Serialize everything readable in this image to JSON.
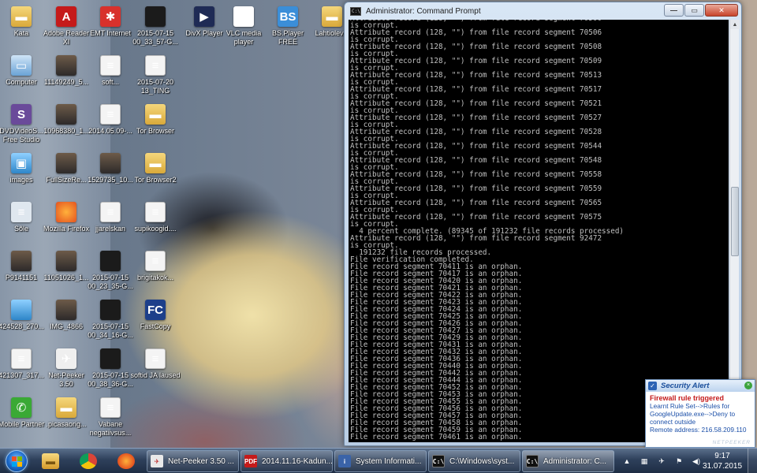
{
  "desktop": {
    "icons": [
      {
        "label": "Kata",
        "icon": "folder-icon",
        "glyph": "▬",
        "style": "g-folder"
      },
      {
        "label": "Adobe Reader XI",
        "icon": "pdf-reader-icon",
        "glyph": "A",
        "style": "g-pdf"
      },
      {
        "label": "EMT Internet",
        "icon": "emt-internet-icon",
        "glyph": "✱",
        "style": "g-red"
      },
      {
        "label": "2015-07-15 00_33_57-G...",
        "icon": "video-thumbnail-icon",
        "glyph": "",
        "style": "g-dark"
      },
      {
        "label": "DivX Player",
        "icon": "divx-player-icon",
        "glyph": "▶",
        "style": "g-divx"
      },
      {
        "label": "VLC media player",
        "icon": "vlc-icon",
        "glyph": "▲",
        "style": "g-vlc"
      },
      {
        "label": "BS.Player FREE",
        "icon": "bsplayer-icon",
        "glyph": "BS",
        "style": "g-bs"
      },
      {
        "label": "Lahtiolev...",
        "icon": "folder-icon",
        "glyph": "▬",
        "style": "g-folder"
      },
      {
        "label": "Computer",
        "icon": "computer-icon",
        "glyph": "▭",
        "style": "g-pc"
      },
      {
        "label": "11149249_5...",
        "icon": "photo-icon",
        "glyph": "",
        "style": "g-photo"
      },
      {
        "label": "soft...",
        "icon": "document-icon",
        "glyph": "≡",
        "style": "g-file"
      },
      {
        "label": "2015-07-20 13_TING",
        "icon": "document-icon",
        "glyph": "≡",
        "style": "g-file"
      },
      {
        "label": "DVDVideoS... Free Studio",
        "icon": "dvd-studio-icon",
        "glyph": "S",
        "style": "g-dvd"
      },
      {
        "label": "10968380_1...",
        "icon": "photo-icon",
        "glyph": "",
        "style": "g-photo"
      },
      {
        "label": "2014.05.09-...",
        "icon": "document-icon",
        "glyph": "≡",
        "style": "g-file"
      },
      {
        "label": "Tor Browser",
        "icon": "folder-icon",
        "glyph": "▬",
        "style": "g-folder"
      },
      {
        "label": "images",
        "icon": "image-folder-icon",
        "glyph": "▣",
        "style": "g-img"
      },
      {
        "label": "FullSizeRe...",
        "icon": "photo-icon",
        "glyph": "",
        "style": "g-photo"
      },
      {
        "label": "1529735_10...",
        "icon": "photo-icon",
        "glyph": "",
        "style": "g-photo"
      },
      {
        "label": "Tor Browser2",
        "icon": "folder-icon",
        "glyph": "▬",
        "style": "g-folder"
      },
      {
        "label": "Sõle",
        "icon": "document-icon",
        "glyph": "≡",
        "style": "g-sole"
      },
      {
        "label": "Mozilla Firefox",
        "icon": "firefox-icon",
        "glyph": "",
        "style": "g-fox"
      },
      {
        "label": "jjarelskan",
        "icon": "document-icon",
        "glyph": "≡",
        "style": "g-file"
      },
      {
        "label": "supikoogid....",
        "icon": "document-icon",
        "glyph": "≡",
        "style": "g-file"
      },
      {
        "label": "P9141151",
        "icon": "photo-icon",
        "glyph": "",
        "style": "g-photo"
      },
      {
        "label": "11051026_1...",
        "icon": "photo-icon",
        "glyph": "",
        "style": "g-photo"
      },
      {
        "label": "2015-07-15 00_23_35-G...",
        "icon": "video-thumbnail-icon",
        "glyph": "",
        "style": "g-dark"
      },
      {
        "label": "brigitakok...",
        "icon": "document-icon",
        "glyph": "≡",
        "style": "g-file"
      },
      {
        "label": "424528_270...",
        "icon": "photo-icon",
        "glyph": "",
        "style": "g-img"
      },
      {
        "label": "IMG_4866",
        "icon": "photo-icon",
        "glyph": "",
        "style": "g-photo"
      },
      {
        "label": "2015-07-15 00_34_16-G...",
        "icon": "video-thumbnail-icon",
        "glyph": "",
        "style": "g-dark"
      },
      {
        "label": "FastCopy",
        "icon": "fastcopy-icon",
        "glyph": "FC",
        "style": "g-fast"
      },
      {
        "label": "421307_317...",
        "icon": "document-icon",
        "glyph": "≡",
        "style": "g-file"
      },
      {
        "label": "Net-Peeker 3.50",
        "icon": "net-peeker-icon",
        "glyph": "✈",
        "style": "g-net"
      },
      {
        "label": "2015-07-15 00_38_36-G...",
        "icon": "video-thumbnail-icon",
        "glyph": "",
        "style": "g-dark"
      },
      {
        "label": "softid JA laused",
        "icon": "document-icon",
        "glyph": "≡",
        "style": "g-file"
      },
      {
        "label": "Mobile Partner",
        "icon": "mobile-partner-icon",
        "glyph": "✆",
        "style": "g-mob"
      },
      {
        "label": ".picasaorig...",
        "icon": "folder-icon",
        "glyph": "▬",
        "style": "g-folder"
      },
      {
        "label": "Vabane negatiivsus...",
        "icon": "document-icon",
        "glyph": "≡",
        "style": "g-file"
      }
    ]
  },
  "console": {
    "title": "Administrator: Command Prompt",
    "icon_text": "C:\\",
    "buttons": {
      "minimize": "—",
      "maximize": "▭",
      "close": "✕"
    },
    "lines": [
      "Attribute record (128, \"\") from file record segment 70500",
      "is corrupt.",
      "Attribute record (128, \"\") from file record segment 70506",
      "is corrupt.",
      "Attribute record (128, \"\") from file record segment 70508",
      "is corrupt.",
      "Attribute record (128, \"\") from file record segment 70509",
      "is corrupt.",
      "Attribute record (128, \"\") from file record segment 70513",
      "is corrupt.",
      "Attribute record (128, \"\") from file record segment 70517",
      "is corrupt.",
      "Attribute record (128, \"\") from file record segment 70521",
      "is corrupt.",
      "Attribute record (128, \"\") from file record segment 70527",
      "is corrupt.",
      "Attribute record (128, \"\") from file record segment 70528",
      "is corrupt.",
      "Attribute record (128, \"\") from file record segment 70544",
      "is corrupt.",
      "Attribute record (128, \"\") from file record segment 70548",
      "is corrupt.",
      "Attribute record (128, \"\") from file record segment 70558",
      "is corrupt.",
      "Attribute record (128, \"\") from file record segment 70559",
      "is corrupt.",
      "Attribute record (128, \"\") from file record segment 70565",
      "is corrupt.",
      "Attribute record (128, \"\") from file record segment 70575",
      "is corrupt.",
      "  4 percent complete. (89345 of 191232 file records processed)",
      "Attribute record (128, \"\") from file record segment 92472",
      "is corrupt.",
      "  191232 file records processed.",
      "File verification completed.",
      "File record segment 70411 is an orphan.",
      "File record segment 70417 is an orphan.",
      "File record segment 70420 is an orphan.",
      "File record segment 70421 is an orphan.",
      "File record segment 70422 is an orphan.",
      "File record segment 70423 is an orphan.",
      "File record segment 70424 is an orphan.",
      "File record segment 70425 is an orphan.",
      "File record segment 70426 is an orphan.",
      "File record segment 70427 is an orphan.",
      "File record segment 70429 is an orphan.",
      "File record segment 70431 is an orphan.",
      "File record segment 70432 is an orphan.",
      "File record segment 70436 is an orphan.",
      "File record segment 70440 is an orphan.",
      "File record segment 70442 is an orphan.",
      "File record segment 70444 is an orphan.",
      "File record segment 70452 is an orphan.",
      "File record segment 70453 is an orphan.",
      "File record segment 70455 is an orphan.",
      "File record segment 70456 is an orphan.",
      "File record segment 70457 is an orphan.",
      "File record segment 70458 is an orphan.",
      "File record segment 70459 is an orphan.",
      "File record segment 70461 is an orphan."
    ]
  },
  "alert": {
    "title": "Security Alert",
    "heading": "Firewall rule triggered",
    "line1": "Learnt Rule Set-->Rules for",
    "line2": "GoogleUpdate.exe-->Deny to",
    "line3": "connect outside",
    "remote": "Remote address: 216.58.209.110",
    "brand": "NETPEEKER",
    "close_glyph": "×"
  },
  "taskbar": {
    "pinned": [
      {
        "name": "explorer-icon",
        "glyph": "▬",
        "style": "p-explorer"
      },
      {
        "name": "chrome-icon",
        "glyph": "",
        "style": "p-chrome"
      },
      {
        "name": "firefox-icon",
        "glyph": "",
        "style": "p-firefox"
      }
    ],
    "tasks": [
      {
        "label": "Net-Peeker 3.50 ...",
        "icon": "net-peeker-icon",
        "glyph": "✈",
        "style": "t-net"
      },
      {
        "label": "2014.11.16-Kadun...",
        "icon": "pdf-icon",
        "glyph": "PDF",
        "style": "t-pdf"
      },
      {
        "label": "System Informati...",
        "icon": "system-info-icon",
        "glyph": "i",
        "style": "t-sys"
      },
      {
        "label": "C:\\Windows\\syst...",
        "icon": "console-icon",
        "glyph": "C:\\",
        "style": "t-cmd"
      },
      {
        "label": "Administrator: C...",
        "icon": "console-icon",
        "glyph": "C:\\",
        "style": "t-cmd"
      }
    ],
    "tray": [
      {
        "name": "tray-expand-icon",
        "glyph": "▲"
      },
      {
        "name": "network-tray-icon",
        "glyph": "▦"
      },
      {
        "name": "netpeeker-tray-icon",
        "glyph": "✈"
      },
      {
        "name": "flag-tray-icon",
        "glyph": "⚑"
      },
      {
        "name": "volume-tray-icon",
        "glyph": "◀)"
      }
    ],
    "time": "9:17",
    "date": "31.07.2015"
  }
}
